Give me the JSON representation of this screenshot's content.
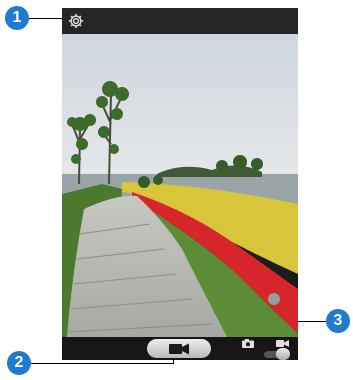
{
  "callouts": [
    {
      "number": "1",
      "target": "settings"
    },
    {
      "number": "2",
      "target": "record"
    },
    {
      "number": "3",
      "target": "mode-switch"
    }
  ],
  "icons": {
    "settings": "gear-icon",
    "record": "video-camera-icon",
    "mode_photo": "camera-icon",
    "mode_video": "video-camera-icon"
  },
  "colors": {
    "callout": "#1f7ad0",
    "topbar": "#262626",
    "bottombar": "#161616"
  }
}
